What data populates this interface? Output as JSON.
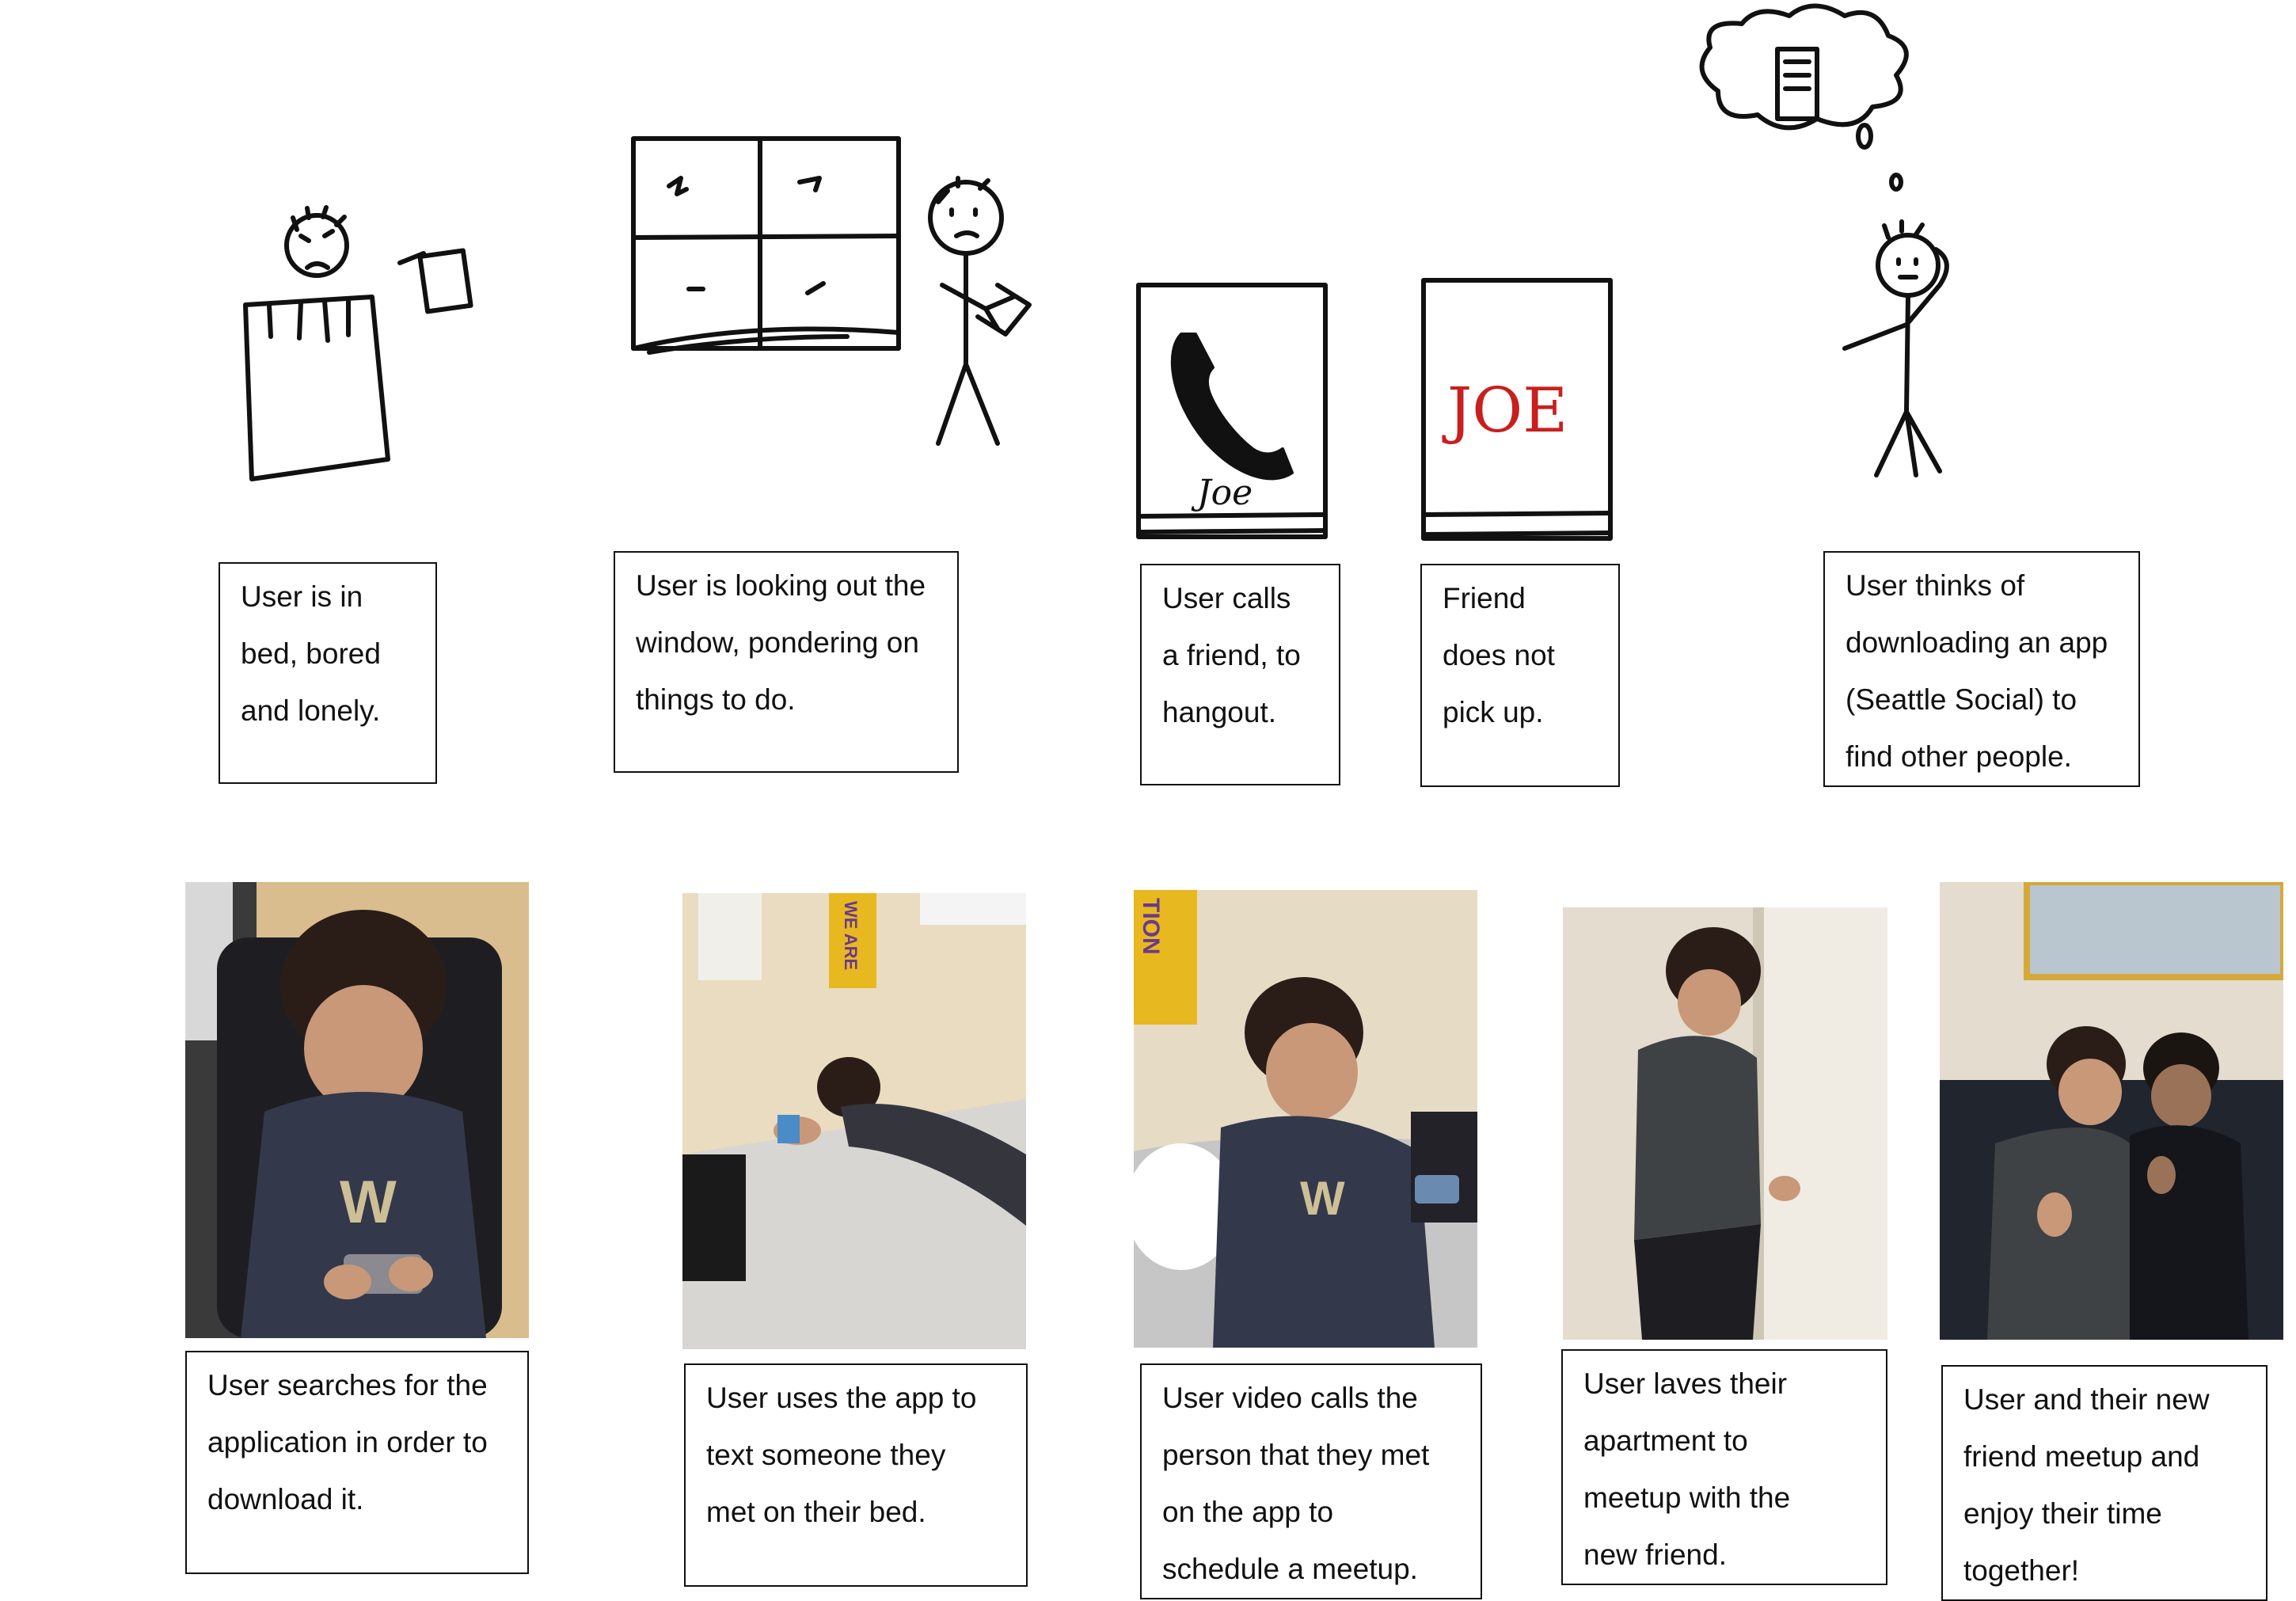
{
  "storyboard": {
    "sketches": [
      {
        "caption": "User is in\nbed, bored\nand lonely."
      },
      {
        "caption": "User is looking out the\nwindow, pondering on\nthings to do."
      },
      {
        "caption": "User calls\na friend, to\nhangout.",
        "phone_label": "Joe"
      },
      {
        "caption": "Friend\ndoes not\npick up.",
        "screen_name": "JOE",
        "name_color": "#c8201e"
      },
      {
        "caption": "User thinks of\ndownloading an app\n(Seattle Social) to\nfind other people."
      }
    ],
    "photos": [
      {
        "caption": "User searches for the\napplication in order to\ndownload it."
      },
      {
        "caption": "User uses the app to\ntext someone they\nmet on their bed."
      },
      {
        "caption": "User video calls the\nperson that they met\non the app to\nschedule a meetup."
      },
      {
        "caption": "User laves their\napartment to\nmeetup with the\nnew friend."
      },
      {
        "caption": "User and their new\nfriend meetup and\nenjoy their time\ntogether!"
      }
    ],
    "photo_prints": {
      "banner_left": "WE ARE",
      "banner_right": "TION",
      "shirt_logo": "W"
    },
    "colors": {
      "banner_yellow": "#e8b820",
      "shirt_navy": "#33394a",
      "wall_cream": "#e9dcc0"
    }
  }
}
